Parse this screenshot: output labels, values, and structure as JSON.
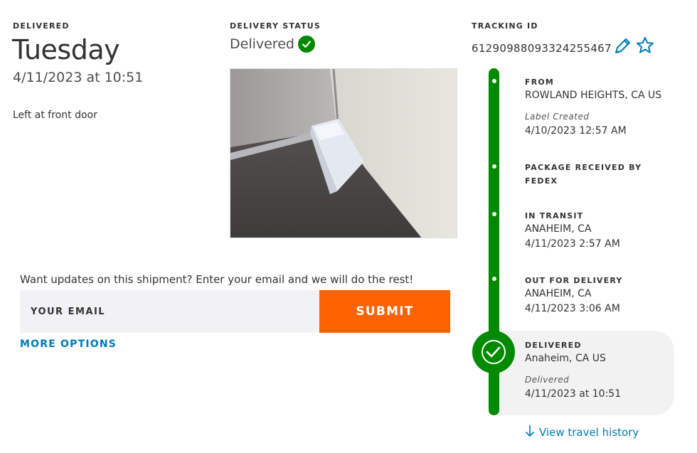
{
  "delivery": {
    "eyebrow": "DELIVERED",
    "day": "Tuesday",
    "datetime": "4/11/2023 at 10:51",
    "note": "Left at front door"
  },
  "status": {
    "eyebrow": "DELIVERY STATUS",
    "text": "Delivered",
    "icon": "check-circle-icon"
  },
  "tracking": {
    "eyebrow": "TRACKING ID",
    "id": "612909880933242554 67",
    "id_exact": "61290988093324255467",
    "edit_icon": "pencil-icon",
    "favorite_icon": "star-icon"
  },
  "photo": {
    "description_icon": "delivery-proof-photo"
  },
  "email_updates": {
    "prompt": "Want updates on this shipment? Enter your email and we will do the rest!",
    "placeholder": "YOUR EMAIL",
    "value": "",
    "submit_label": "SUBMIT",
    "more_options_label": "MORE OPTIONS"
  },
  "timeline": {
    "from": {
      "title": "FROM",
      "location": "ROWLAND HEIGHTS, CA US",
      "label": "Label Created",
      "date": "4/10/2023 12:57 AM"
    },
    "received": {
      "title": "PACKAGE RECEIVED BY FEDEX"
    },
    "in_transit": {
      "title": "IN TRANSIT",
      "location": "ANAHEIM, CA",
      "date": "4/11/2023 2:57 AM"
    },
    "out_for_delivery": {
      "title": "OUT FOR DELIVERY",
      "location": "ANAHEIM, CA",
      "date": "4/11/2023 3:06 AM"
    },
    "delivered": {
      "title": "DELIVERED",
      "location": "Anaheim, CA US",
      "label": "Delivered",
      "date": "4/11/2023 at 10:51"
    },
    "view_history_label": "View travel history",
    "view_history_icon": "arrow-down-icon"
  },
  "colors": {
    "accent_green": "#008a00",
    "submit_orange": "#ff6200",
    "link_blue": "#007ab7",
    "input_bg": "#f2f2f5"
  }
}
